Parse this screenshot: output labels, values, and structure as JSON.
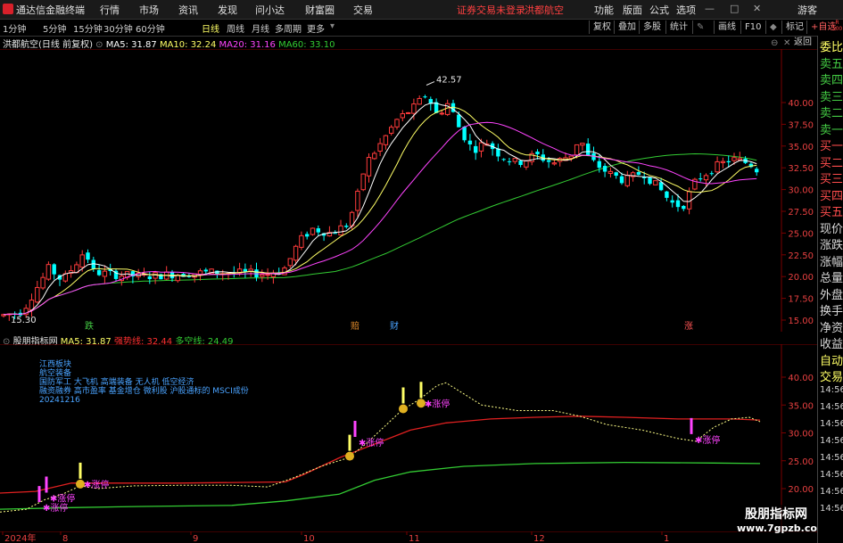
{
  "titlebar": {
    "app_title": "通达信金融终端",
    "menus": [
      "行情",
      "市场",
      "资讯",
      "发现",
      "问小达",
      "财富圈",
      "交易"
    ],
    "status": "证券交易未登录",
    "stock_name": "洪都航空",
    "right_menus": [
      "功能",
      "版面",
      "公式",
      "选项"
    ],
    "guest": "游客"
  },
  "toolbar": {
    "timeframes": [
      "1分钟",
      "5分钟",
      "15分钟",
      "30分钟",
      "60分钟",
      "日线",
      "周线",
      "月线",
      "多周期",
      "更多"
    ],
    "active": "日线",
    "buttons": [
      "复权",
      "叠加",
      "多股",
      "统计",
      "画线",
      "F10",
      "标记",
      "+自选",
      "返回"
    ]
  },
  "main_info": {
    "title": "洪都航空(日线 前复权)",
    "ma5": "MA5: 31.87",
    "ma10": "MA10: 32.24",
    "ma20": "MA20: 31.16",
    "ma60": "MA60: 33.10"
  },
  "main_chart": {
    "y_ticks": [
      "40.00",
      "37.50",
      "35.00",
      "32.50",
      "30.00",
      "27.50",
      "25.00",
      "22.50",
      "20.00",
      "17.50",
      "15.00"
    ],
    "high_label": "42.57",
    "low_label": "15.30",
    "markers": [
      {
        "text": "跌",
        "color": "#44cc44"
      },
      {
        "text": "赔",
        "color": "#e08a2a"
      },
      {
        "text": "财",
        "color": "#4aa3ff"
      },
      {
        "text": "涨",
        "color": "#ff5555"
      }
    ]
  },
  "sub_info": {
    "title": "股朋指标网",
    "ma5": "MA5: 31.87",
    "strong_line": "强势线: 32.44",
    "bull_line": "多空线: 24.49"
  },
  "sub_chart": {
    "y_ticks": [
      "40.00",
      "35.00",
      "30.00",
      "25.00",
      "20.00"
    ],
    "notes": [
      "江西板块",
      "航空装备",
      "国防军工 大飞机 高端装备 无人机 低空经济",
      "融资融券 高市盈率 基金增仓 微利股 沪股通标的 MSCI成份",
      "20241216"
    ],
    "zt_label": "涨停",
    "zt_count": 6
  },
  "x_axis": [
    "2024年",
    "8",
    "9",
    "10",
    "11",
    "12",
    "1"
  ],
  "right_panel": {
    "items": [
      "委比",
      "卖五",
      "卖四",
      "卖三",
      "卖二",
      "卖一",
      "买一",
      "买二",
      "买三",
      "买四",
      "买五",
      "现价",
      "涨跌",
      "涨幅",
      "总量",
      "外盘",
      "换手",
      "净资",
      "收益",
      "自动",
      "交易"
    ],
    "times": [
      "14:56",
      "14:56",
      "14:56",
      "14:56",
      "14:56",
      "14:56",
      "14:56",
      "14:56"
    ],
    "badge": "R\n500"
  },
  "watermark": {
    "line1": "股朋指标网",
    "line2": "www.7gpzb.com"
  },
  "colors": {
    "up": "#ff3b3b",
    "down": "#00ffff",
    "ma5": "#ffffff",
    "ma10": "#ffff66",
    "ma20": "#ff44ff",
    "ma60": "#33cc33",
    "strong": "#e02020",
    "bull": "#33cc33"
  }
}
